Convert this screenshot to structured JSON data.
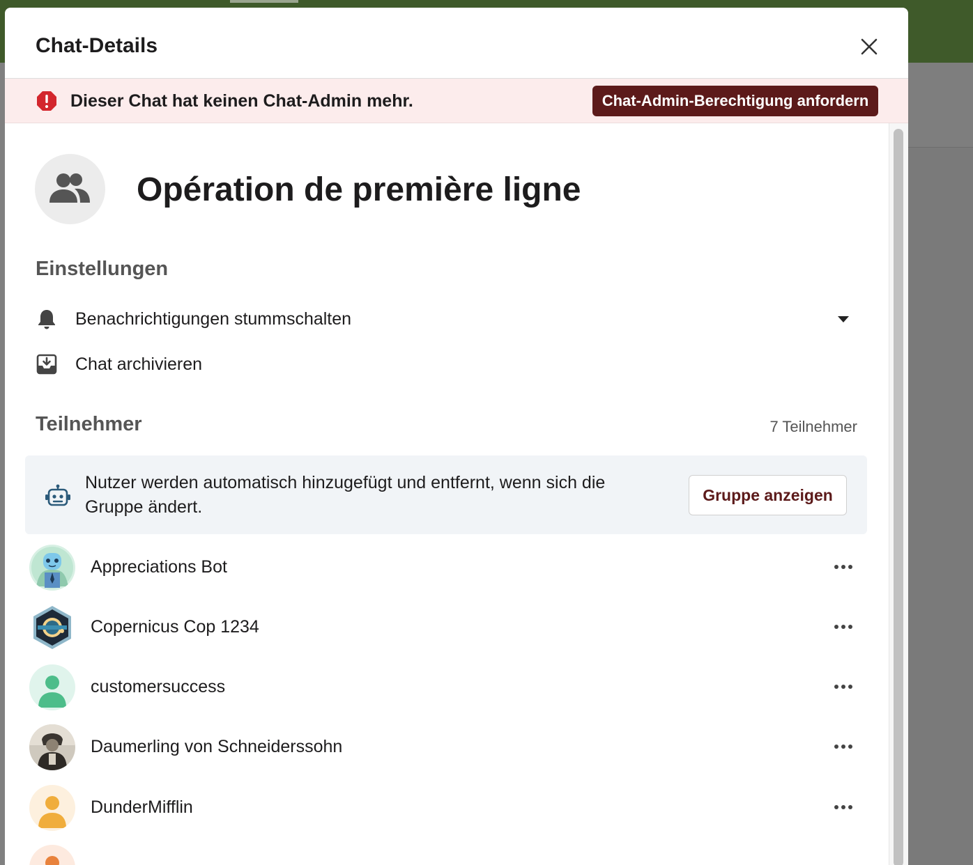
{
  "modal": {
    "title": "Chat-Details",
    "close_icon": "close-icon"
  },
  "alert": {
    "icon": "error-icon",
    "text": "Dieser Chat hat keinen Chat-Admin mehr.",
    "button_label": "Chat-Admin-Berechtigung anfordern",
    "accent_color": "#5c1a1a"
  },
  "group": {
    "avatar_icon": "group-users-icon",
    "name": "Opération de première ligne"
  },
  "settings": {
    "title": "Einstellungen",
    "items": [
      {
        "icon": "bell-icon",
        "label": "Benachrichtigungen stummschalten",
        "has_dropdown": true
      },
      {
        "icon": "archive-icon",
        "label": "Chat archivieren"
      }
    ]
  },
  "members": {
    "title": "Teilnehmer",
    "count_label": "7 Teilnehmer",
    "info_text": "Nutzer werden automatisch hinzugefügt und entfernt, wenn sich die Gruppe ändert.",
    "info_icon": "robot-icon",
    "group_button_label": "Gruppe anzeigen",
    "list": [
      {
        "name": "Appreciations Bot",
        "avatar": "bot-avatar"
      },
      {
        "name": "Copernicus Cop 1234",
        "avatar": "hexagon-badge-avatar"
      },
      {
        "name": "customersuccess",
        "avatar": "default-user-avatar-green"
      },
      {
        "name": "Daumerling von Schneiderssohn",
        "avatar": "photo-avatar"
      },
      {
        "name": "DunderMifflin",
        "avatar": "default-user-avatar-orange"
      },
      {
        "name": "",
        "avatar": "default-user-avatar-orange"
      }
    ]
  }
}
